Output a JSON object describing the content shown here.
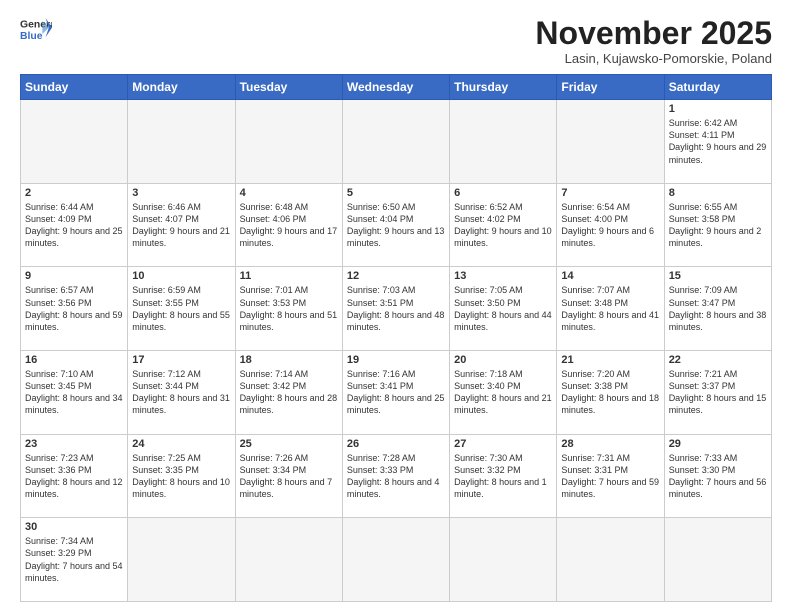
{
  "header": {
    "logo_general": "General",
    "logo_blue": "Blue",
    "month_title": "November 2025",
    "location": "Lasin, Kujawsko-Pomorskie, Poland"
  },
  "days_of_week": [
    "Sunday",
    "Monday",
    "Tuesday",
    "Wednesday",
    "Thursday",
    "Friday",
    "Saturday"
  ],
  "weeks": [
    [
      {
        "day": "",
        "text": ""
      },
      {
        "day": "",
        "text": ""
      },
      {
        "day": "",
        "text": ""
      },
      {
        "day": "",
        "text": ""
      },
      {
        "day": "",
        "text": ""
      },
      {
        "day": "",
        "text": ""
      },
      {
        "day": "1",
        "text": "Sunrise: 6:42 AM\nSunset: 4:11 PM\nDaylight: 9 hours and 29 minutes."
      }
    ],
    [
      {
        "day": "2",
        "text": "Sunrise: 6:44 AM\nSunset: 4:09 PM\nDaylight: 9 hours and 25 minutes."
      },
      {
        "day": "3",
        "text": "Sunrise: 6:46 AM\nSunset: 4:07 PM\nDaylight: 9 hours and 21 minutes."
      },
      {
        "day": "4",
        "text": "Sunrise: 6:48 AM\nSunset: 4:06 PM\nDaylight: 9 hours and 17 minutes."
      },
      {
        "day": "5",
        "text": "Sunrise: 6:50 AM\nSunset: 4:04 PM\nDaylight: 9 hours and 13 minutes."
      },
      {
        "day": "6",
        "text": "Sunrise: 6:52 AM\nSunset: 4:02 PM\nDaylight: 9 hours and 10 minutes."
      },
      {
        "day": "7",
        "text": "Sunrise: 6:54 AM\nSunset: 4:00 PM\nDaylight: 9 hours and 6 minutes."
      },
      {
        "day": "8",
        "text": "Sunrise: 6:55 AM\nSunset: 3:58 PM\nDaylight: 9 hours and 2 minutes."
      }
    ],
    [
      {
        "day": "9",
        "text": "Sunrise: 6:57 AM\nSunset: 3:56 PM\nDaylight: 8 hours and 59 minutes."
      },
      {
        "day": "10",
        "text": "Sunrise: 6:59 AM\nSunset: 3:55 PM\nDaylight: 8 hours and 55 minutes."
      },
      {
        "day": "11",
        "text": "Sunrise: 7:01 AM\nSunset: 3:53 PM\nDaylight: 8 hours and 51 minutes."
      },
      {
        "day": "12",
        "text": "Sunrise: 7:03 AM\nSunset: 3:51 PM\nDaylight: 8 hours and 48 minutes."
      },
      {
        "day": "13",
        "text": "Sunrise: 7:05 AM\nSunset: 3:50 PM\nDaylight: 8 hours and 44 minutes."
      },
      {
        "day": "14",
        "text": "Sunrise: 7:07 AM\nSunset: 3:48 PM\nDaylight: 8 hours and 41 minutes."
      },
      {
        "day": "15",
        "text": "Sunrise: 7:09 AM\nSunset: 3:47 PM\nDaylight: 8 hours and 38 minutes."
      }
    ],
    [
      {
        "day": "16",
        "text": "Sunrise: 7:10 AM\nSunset: 3:45 PM\nDaylight: 8 hours and 34 minutes."
      },
      {
        "day": "17",
        "text": "Sunrise: 7:12 AM\nSunset: 3:44 PM\nDaylight: 8 hours and 31 minutes."
      },
      {
        "day": "18",
        "text": "Sunrise: 7:14 AM\nSunset: 3:42 PM\nDaylight: 8 hours and 28 minutes."
      },
      {
        "day": "19",
        "text": "Sunrise: 7:16 AM\nSunset: 3:41 PM\nDaylight: 8 hours and 25 minutes."
      },
      {
        "day": "20",
        "text": "Sunrise: 7:18 AM\nSunset: 3:40 PM\nDaylight: 8 hours and 21 minutes."
      },
      {
        "day": "21",
        "text": "Sunrise: 7:20 AM\nSunset: 3:38 PM\nDaylight: 8 hours and 18 minutes."
      },
      {
        "day": "22",
        "text": "Sunrise: 7:21 AM\nSunset: 3:37 PM\nDaylight: 8 hours and 15 minutes."
      }
    ],
    [
      {
        "day": "23",
        "text": "Sunrise: 7:23 AM\nSunset: 3:36 PM\nDaylight: 8 hours and 12 minutes."
      },
      {
        "day": "24",
        "text": "Sunrise: 7:25 AM\nSunset: 3:35 PM\nDaylight: 8 hours and 10 minutes."
      },
      {
        "day": "25",
        "text": "Sunrise: 7:26 AM\nSunset: 3:34 PM\nDaylight: 8 hours and 7 minutes."
      },
      {
        "day": "26",
        "text": "Sunrise: 7:28 AM\nSunset: 3:33 PM\nDaylight: 8 hours and 4 minutes."
      },
      {
        "day": "27",
        "text": "Sunrise: 7:30 AM\nSunset: 3:32 PM\nDaylight: 8 hours and 1 minute."
      },
      {
        "day": "28",
        "text": "Sunrise: 7:31 AM\nSunset: 3:31 PM\nDaylight: 7 hours and 59 minutes."
      },
      {
        "day": "29",
        "text": "Sunrise: 7:33 AM\nSunset: 3:30 PM\nDaylight: 7 hours and 56 minutes."
      }
    ],
    [
      {
        "day": "30",
        "text": "Sunrise: 7:34 AM\nSunset: 3:29 PM\nDaylight: 7 hours and 54 minutes."
      },
      {
        "day": "",
        "text": ""
      },
      {
        "day": "",
        "text": ""
      },
      {
        "day": "",
        "text": ""
      },
      {
        "day": "",
        "text": ""
      },
      {
        "day": "",
        "text": ""
      },
      {
        "day": "",
        "text": ""
      }
    ]
  ]
}
